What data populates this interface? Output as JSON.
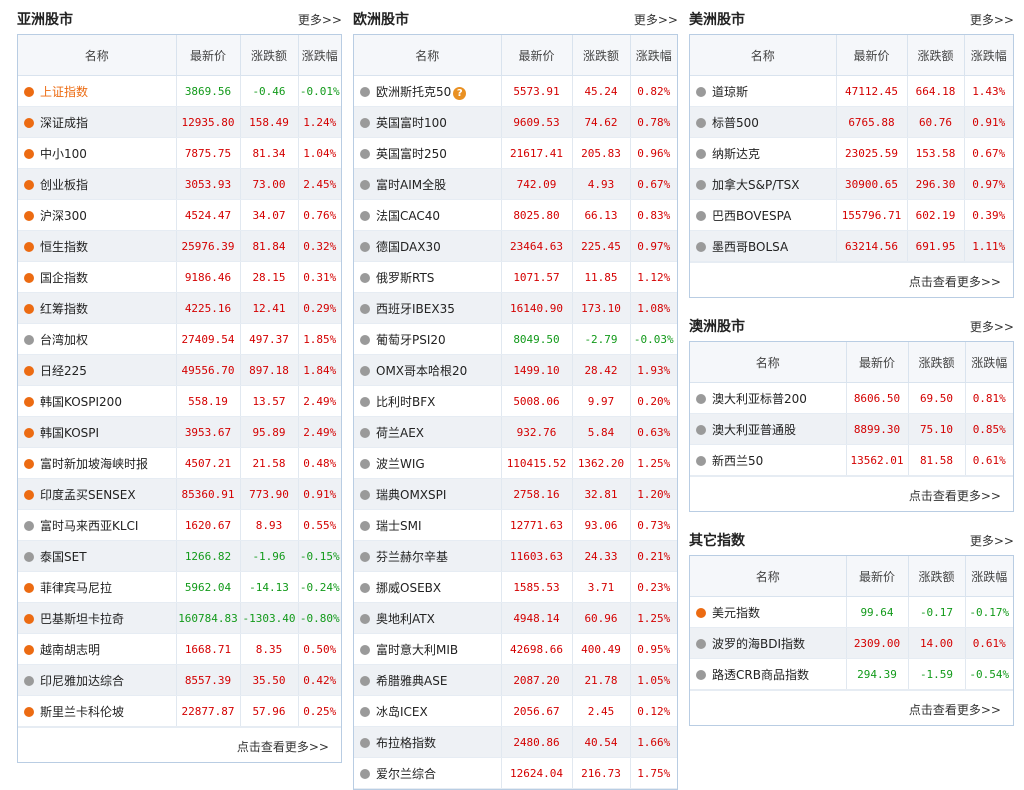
{
  "panels": {
    "asia": {
      "title": "亚洲股市",
      "more": "更多>>",
      "footer": "点击查看更多>>",
      "headers": [
        "名称",
        "最新价",
        "涨跌额",
        "涨跌幅"
      ],
      "rows": [
        {
          "name": "上证指数",
          "price": "3869.56",
          "change": "-0.46",
          "pct": "-0.01%",
          "dot": "orange",
          "dir": "down",
          "hl": true
        },
        {
          "name": "深证成指",
          "price": "12935.80",
          "change": "158.49",
          "pct": "1.24%",
          "dot": "orange",
          "dir": "up"
        },
        {
          "name": "中小100",
          "price": "7875.75",
          "change": "81.34",
          "pct": "1.04%",
          "dot": "orange",
          "dir": "up"
        },
        {
          "name": "创业板指",
          "price": "3053.93",
          "change": "73.00",
          "pct": "2.45%",
          "dot": "orange",
          "dir": "up"
        },
        {
          "name": "沪深300",
          "price": "4524.47",
          "change": "34.07",
          "pct": "0.76%",
          "dot": "orange",
          "dir": "up"
        },
        {
          "name": "恒生指数",
          "price": "25976.39",
          "change": "81.84",
          "pct": "0.32%",
          "dot": "orange",
          "dir": "up"
        },
        {
          "name": "国企指数",
          "price": "9186.46",
          "change": "28.15",
          "pct": "0.31%",
          "dot": "orange",
          "dir": "up"
        },
        {
          "name": "红筹指数",
          "price": "4225.16",
          "change": "12.41",
          "pct": "0.29%",
          "dot": "orange",
          "dir": "up"
        },
        {
          "name": "台湾加权",
          "price": "27409.54",
          "change": "497.37",
          "pct": "1.85%",
          "dot": "gray",
          "dir": "up"
        },
        {
          "name": "日经225",
          "price": "49556.70",
          "change": "897.18",
          "pct": "1.84%",
          "dot": "orange",
          "dir": "up"
        },
        {
          "name": "韩国KOSPI200",
          "price": "558.19",
          "change": "13.57",
          "pct": "2.49%",
          "dot": "orange",
          "dir": "up"
        },
        {
          "name": "韩国KOSPI",
          "price": "3953.67",
          "change": "95.89",
          "pct": "2.49%",
          "dot": "orange",
          "dir": "up"
        },
        {
          "name": "富时新加坡海峡时报",
          "price": "4507.21",
          "change": "21.58",
          "pct": "0.48%",
          "dot": "orange",
          "dir": "up"
        },
        {
          "name": "印度孟买SENSEX",
          "price": "85360.91",
          "change": "773.90",
          "pct": "0.91%",
          "dot": "orange",
          "dir": "up"
        },
        {
          "name": "富时马来西亚KLCI",
          "price": "1620.67",
          "change": "8.93",
          "pct": "0.55%",
          "dot": "gray",
          "dir": "up"
        },
        {
          "name": "泰国SET",
          "price": "1266.82",
          "change": "-1.96",
          "pct": "-0.15%",
          "dot": "gray",
          "dir": "down"
        },
        {
          "name": "菲律宾马尼拉",
          "price": "5962.04",
          "change": "-14.13",
          "pct": "-0.24%",
          "dot": "orange",
          "dir": "down"
        },
        {
          "name": "巴基斯坦卡拉奇",
          "price": "160784.83",
          "change": "-1303.40",
          "pct": "-0.80%",
          "dot": "orange",
          "dir": "down"
        },
        {
          "name": "越南胡志明",
          "price": "1668.71",
          "change": "8.35",
          "pct": "0.50%",
          "dot": "orange",
          "dir": "up"
        },
        {
          "name": "印尼雅加达综合",
          "price": "8557.39",
          "change": "35.50",
          "pct": "0.42%",
          "dot": "gray",
          "dir": "up"
        },
        {
          "name": "斯里兰卡科伦坡",
          "price": "22877.87",
          "change": "57.96",
          "pct": "0.25%",
          "dot": "orange",
          "dir": "up"
        }
      ]
    },
    "europe": {
      "title": "欧洲股市",
      "more": "更多>>",
      "headers": [
        "名称",
        "最新价",
        "涨跌额",
        "涨跌幅"
      ],
      "help_icon": "?",
      "rows": [
        {
          "name": "欧洲斯托克50",
          "price": "5573.91",
          "change": "45.24",
          "pct": "0.82%",
          "dot": "gray",
          "dir": "up",
          "help": true
        },
        {
          "name": "英国富时100",
          "price": "9609.53",
          "change": "74.62",
          "pct": "0.78%",
          "dot": "gray",
          "dir": "up"
        },
        {
          "name": "英国富时250",
          "price": "21617.41",
          "change": "205.83",
          "pct": "0.96%",
          "dot": "gray",
          "dir": "up"
        },
        {
          "name": "富时AIM全股",
          "price": "742.09",
          "change": "4.93",
          "pct": "0.67%",
          "dot": "gray",
          "dir": "up"
        },
        {
          "name": "法国CAC40",
          "price": "8025.80",
          "change": "66.13",
          "pct": "0.83%",
          "dot": "gray",
          "dir": "up"
        },
        {
          "name": "德国DAX30",
          "price": "23464.63",
          "change": "225.45",
          "pct": "0.97%",
          "dot": "gray",
          "dir": "up"
        },
        {
          "name": "俄罗斯RTS",
          "price": "1071.57",
          "change": "11.85",
          "pct": "1.12%",
          "dot": "gray",
          "dir": "up"
        },
        {
          "name": "西班牙IBEX35",
          "price": "16140.90",
          "change": "173.10",
          "pct": "1.08%",
          "dot": "gray",
          "dir": "up"
        },
        {
          "name": "葡萄牙PSI20",
          "price": "8049.50",
          "change": "-2.79",
          "pct": "-0.03%",
          "dot": "gray",
          "dir": "down"
        },
        {
          "name": "OMX哥本哈根20",
          "price": "1499.10",
          "change": "28.42",
          "pct": "1.93%",
          "dot": "gray",
          "dir": "up"
        },
        {
          "name": "比利时BFX",
          "price": "5008.06",
          "change": "9.97",
          "pct": "0.20%",
          "dot": "gray",
          "dir": "up"
        },
        {
          "name": "荷兰AEX",
          "price": "932.76",
          "change": "5.84",
          "pct": "0.63%",
          "dot": "gray",
          "dir": "up"
        },
        {
          "name": "波兰WIG",
          "price": "110415.52",
          "change": "1362.20",
          "pct": "1.25%",
          "dot": "gray",
          "dir": "up"
        },
        {
          "name": "瑞典OMXSPI",
          "price": "2758.16",
          "change": "32.81",
          "pct": "1.20%",
          "dot": "gray",
          "dir": "up"
        },
        {
          "name": "瑞士SMI",
          "price": "12771.63",
          "change": "93.06",
          "pct": "0.73%",
          "dot": "gray",
          "dir": "up"
        },
        {
          "name": "芬兰赫尔辛基",
          "price": "11603.63",
          "change": "24.33",
          "pct": "0.21%",
          "dot": "gray",
          "dir": "up"
        },
        {
          "name": "挪威OSEBX",
          "price": "1585.53",
          "change": "3.71",
          "pct": "0.23%",
          "dot": "gray",
          "dir": "up"
        },
        {
          "name": "奥地利ATX",
          "price": "4948.14",
          "change": "60.96",
          "pct": "1.25%",
          "dot": "gray",
          "dir": "up"
        },
        {
          "name": "富时意大利MIB",
          "price": "42698.66",
          "change": "400.49",
          "pct": "0.95%",
          "dot": "gray",
          "dir": "up"
        },
        {
          "name": "希腊雅典ASE",
          "price": "2087.20",
          "change": "21.78",
          "pct": "1.05%",
          "dot": "gray",
          "dir": "up"
        },
        {
          "name": "冰岛ICEX",
          "price": "2056.67",
          "change": "2.45",
          "pct": "0.12%",
          "dot": "gray",
          "dir": "up"
        },
        {
          "name": "布拉格指数",
          "price": "2480.86",
          "change": "40.54",
          "pct": "1.66%",
          "dot": "gray",
          "dir": "up"
        },
        {
          "name": "爱尔兰综合",
          "price": "12624.04",
          "change": "216.73",
          "pct": "1.75%",
          "dot": "gray",
          "dir": "up"
        }
      ]
    },
    "america": {
      "title": "美洲股市",
      "more": "更多>>",
      "footer": "点击查看更多>>",
      "headers": [
        "名称",
        "最新价",
        "涨跌额",
        "涨跌幅"
      ],
      "rows": [
        {
          "name": "道琼斯",
          "price": "47112.45",
          "change": "664.18",
          "pct": "1.43%",
          "dot": "gray",
          "dir": "up"
        },
        {
          "name": "标普500",
          "price": "6765.88",
          "change": "60.76",
          "pct": "0.91%",
          "dot": "gray",
          "dir": "up"
        },
        {
          "name": "纳斯达克",
          "price": "23025.59",
          "change": "153.58",
          "pct": "0.67%",
          "dot": "gray",
          "dir": "up"
        },
        {
          "name": "加拿大S&P/TSX",
          "price": "30900.65",
          "change": "296.30",
          "pct": "0.97%",
          "dot": "gray",
          "dir": "up"
        },
        {
          "name": "巴西BOVESPA",
          "price": "155796.71",
          "change": "602.19",
          "pct": "0.39%",
          "dot": "gray",
          "dir": "up"
        },
        {
          "name": "墨西哥BOLSA",
          "price": "63214.56",
          "change": "691.95",
          "pct": "1.11%",
          "dot": "gray",
          "dir": "up"
        }
      ]
    },
    "oceania": {
      "title": "澳洲股市",
      "more": "更多>>",
      "footer": "点击查看更多>>",
      "headers": [
        "名称",
        "最新价",
        "涨跌额",
        "涨跌幅"
      ],
      "rows": [
        {
          "name": "澳大利亚标普200",
          "price": "8606.50",
          "change": "69.50",
          "pct": "0.81%",
          "dot": "gray",
          "dir": "up"
        },
        {
          "name": "澳大利亚普通股",
          "price": "8899.30",
          "change": "75.10",
          "pct": "0.85%",
          "dot": "gray",
          "dir": "up"
        },
        {
          "name": "新西兰50",
          "price": "13562.01",
          "change": "81.58",
          "pct": "0.61%",
          "dot": "gray",
          "dir": "up"
        }
      ]
    },
    "other": {
      "title": "其它指数",
      "more": "更多>>",
      "footer": "点击查看更多>>",
      "headers": [
        "名称",
        "最新价",
        "涨跌额",
        "涨跌幅"
      ],
      "rows": [
        {
          "name": "美元指数",
          "price": "99.64",
          "change": "-0.17",
          "pct": "-0.17%",
          "dot": "orange",
          "dir": "down"
        },
        {
          "name": "波罗的海BDI指数",
          "price": "2309.00",
          "change": "14.00",
          "pct": "0.61%",
          "dot": "gray",
          "dir": "up"
        },
        {
          "name": "路透CRB商品指数",
          "price": "294.39",
          "change": "-1.59",
          "pct": "-0.54%",
          "dot": "gray",
          "dir": "down"
        }
      ]
    }
  }
}
